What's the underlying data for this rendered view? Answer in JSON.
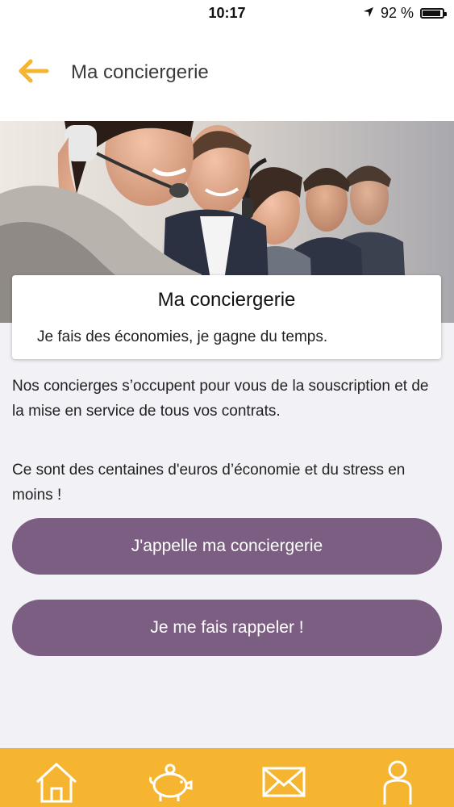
{
  "status_bar": {
    "time": "10:17",
    "battery_text": "92 %",
    "battery_level": 0.92
  },
  "header": {
    "title": "Ma conciergerie",
    "back_icon": "arrow-left-icon"
  },
  "card": {
    "title": "Ma conciergerie",
    "subtitle": "Je fais des économies, je gagne du temps."
  },
  "content": {
    "paragraph1": "Nos concierges s’occupent pour vous de la souscription et de la mise en service de tous vos contrats.",
    "paragraph2": "Ce sont des centaines d'euros d’économie et du stress en moins !"
  },
  "actions": {
    "call_label": "J'appelle ma conciergerie",
    "callback_label": "Je me fais rappeler !"
  },
  "tab_bar": {
    "items": [
      {
        "icon": "home-icon"
      },
      {
        "icon": "piggy-bank-icon"
      },
      {
        "icon": "mail-icon"
      },
      {
        "icon": "user-icon"
      }
    ]
  },
  "colors": {
    "accent": "#f6b531",
    "button": "#7b5e82",
    "background": "#f2f1f6"
  }
}
